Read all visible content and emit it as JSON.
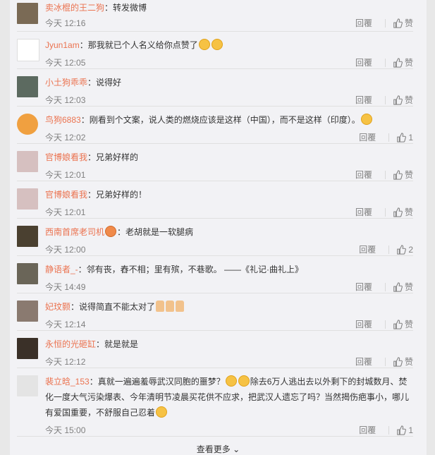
{
  "comments": [
    {
      "user": "卖冰棍的王二狗",
      "text": "：转发微博",
      "time": "今天 12:16",
      "reply": "回覆",
      "like": "赞",
      "avatar_color": "#7a6a55"
    },
    {
      "user": "Jyun1am",
      "text": "：那我就已个人名义给你点赞了",
      "time": "今天 12:05",
      "reply": "回覆",
      "like": "赞",
      "avatar_color": "#ffffff"
    },
    {
      "user": "小土狗乖乖",
      "text": "：说得好",
      "time": "今天 12:03",
      "reply": "回覆",
      "like": "赞",
      "avatar_color": "#5c6a60"
    },
    {
      "user": "鸟狗6883",
      "text": "：刚看到个文案，说人类的燃烧应该是这样（中国），而不是这样（印度）。",
      "time": "今天 12:02",
      "reply": "回覆",
      "like": "1",
      "avatar_color": "#f0a040"
    },
    {
      "user": "官博娘看我",
      "text": "：兄弟好样的",
      "time": "今天 12:01",
      "reply": "回覆",
      "like": "赞",
      "avatar_color": "#d6c0c0"
    },
    {
      "user": "官博娘看我",
      "text": "：兄弟好样的！",
      "time": "今天 12:01",
      "reply": "回覆",
      "like": "赞",
      "avatar_color": "#d6c0c0"
    },
    {
      "user": "西南首席老司机",
      "text": "：老胡就是一软腿病",
      "time": "今天 12:00",
      "reply": "回覆",
      "like": "2",
      "avatar_color": "#4a4030"
    },
    {
      "user": "静语者_-",
      "text": "：邻有丧，舂不相；里有殡，不巷歌。 ——《礼记·曲礼上》",
      "time": "今天 14:49",
      "reply": "回覆",
      "like": "赞",
      "avatar_color": "#6a6558"
    },
    {
      "user": "妃玟颢",
      "text": "：说得简直不能太对了",
      "time": "今天 12:14",
      "reply": "回覆",
      "like": "赞",
      "avatar_color": "#8a7a70"
    },
    {
      "user": "永恒的光砸缸",
      "text": "：就是就是",
      "time": "今天 12:12",
      "reply": "回覆",
      "like": "赞",
      "avatar_color": "#3a3028"
    },
    {
      "user": "裴立晗_153",
      "text": "：真就一遍遍羞辱武汉同胞的噩梦？",
      "text2": "除去6万人逃出去以外剩下的封城数月、焚化一度大气污染爆表、今年清明节凌晨买花供不应求，把武汉人遗忘了吗？当然揭伤疤事小，哪儿有爱国重要，不舒服自己忍着",
      "time": "今天 15:00",
      "reply": "回覆",
      "like": "1",
      "avatar_color": "#e4e4e4"
    }
  ],
  "more_label": "查看更多"
}
